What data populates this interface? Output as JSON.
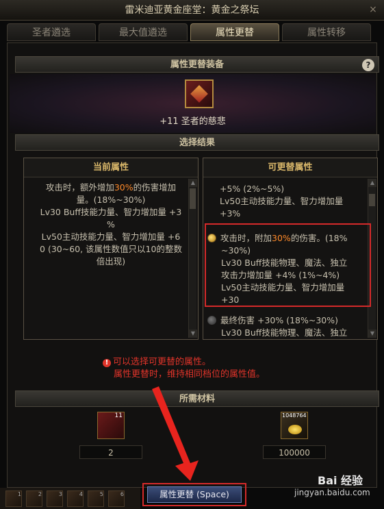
{
  "window": {
    "title": "雷米迪亚黄金座堂：黄金之祭坛",
    "close_glyph": "×"
  },
  "tabs": [
    {
      "label": "圣者遴选",
      "active": false
    },
    {
      "label": "最大值遴选",
      "active": false
    },
    {
      "label": "属性更替",
      "active": true
    },
    {
      "label": "属性转移",
      "active": false
    }
  ],
  "equip_section": {
    "header": "属性更替装备",
    "help_glyph": "?",
    "item": {
      "plus": "+11",
      "name": "圣者的慈悲"
    }
  },
  "result_section": {
    "header": "选择结果"
  },
  "current_box": {
    "header": "当前属性",
    "lines": [
      {
        "pre": "攻击时，额外增加",
        "hl": "30%",
        "post": "的伤害增加"
      },
      {
        "pre": "量。(18%~30%)",
        "hl": "",
        "post": ""
      },
      {
        "pre": "Lv30 Buff技能力量、智力增加量 +3",
        "hl": "",
        "post": ""
      },
      {
        "pre": "%",
        "hl": "",
        "post": ""
      },
      {
        "pre": "Lv50主动技能力量、智力增加量 +6",
        "hl": "",
        "post": ""
      },
      {
        "pre": "0 (30~60, 该属性数值只以10的整数",
        "hl": "",
        "post": ""
      },
      {
        "pre": "倍出现)",
        "hl": "",
        "post": ""
      }
    ]
  },
  "replace_box": {
    "header": "可更替属性",
    "top_lines": [
      "+5% (2%~5%)",
      "Lv50主动技能力量、智力增加量",
      "+3%"
    ],
    "selected_option": {
      "lines": [
        {
          "pre": "攻击时，附加",
          "hl": "30%",
          "post": "的伤害。(18%"
        },
        {
          "pre": "~30%)",
          "hl": "",
          "post": ""
        },
        {
          "pre": "Lv30 Buff技能物理、魔法、独立",
          "hl": "",
          "post": ""
        },
        {
          "pre": "攻击力增加量 +4% (1%~4%)",
          "hl": "",
          "post": ""
        },
        {
          "pre": "Lv50主动技能力量、智力增加量",
          "hl": "",
          "post": ""
        },
        {
          "pre": "+30",
          "hl": "",
          "post": ""
        }
      ]
    },
    "other_option": {
      "lines": [
        {
          "pre": "最终伤害 +30% (18%~30%)",
          "hl": "",
          "post": ""
        },
        {
          "pre": "Lv30 Buff技能物理、魔法、独立",
          "hl": "",
          "post": ""
        }
      ]
    }
  },
  "warning": {
    "icon": "!",
    "line1": "可以选择可更替的属性。",
    "line2": "属性更替时，维持相同档位的属性值。"
  },
  "materials": {
    "header": "所需材料",
    "items": [
      {
        "badge": "11",
        "count": "2",
        "icon": "chest-icon"
      },
      {
        "badge": "1048764",
        "count": "100000",
        "icon": "gold-icon"
      }
    ]
  },
  "action_button": {
    "label": "属性更替 (Space)"
  },
  "skillbar": {
    "slots": [
      "1",
      "2",
      "3",
      "4",
      "5",
      "6"
    ]
  },
  "watermark": {
    "logo": "Bai 经验",
    "url": "jingyan.baidu.com"
  }
}
